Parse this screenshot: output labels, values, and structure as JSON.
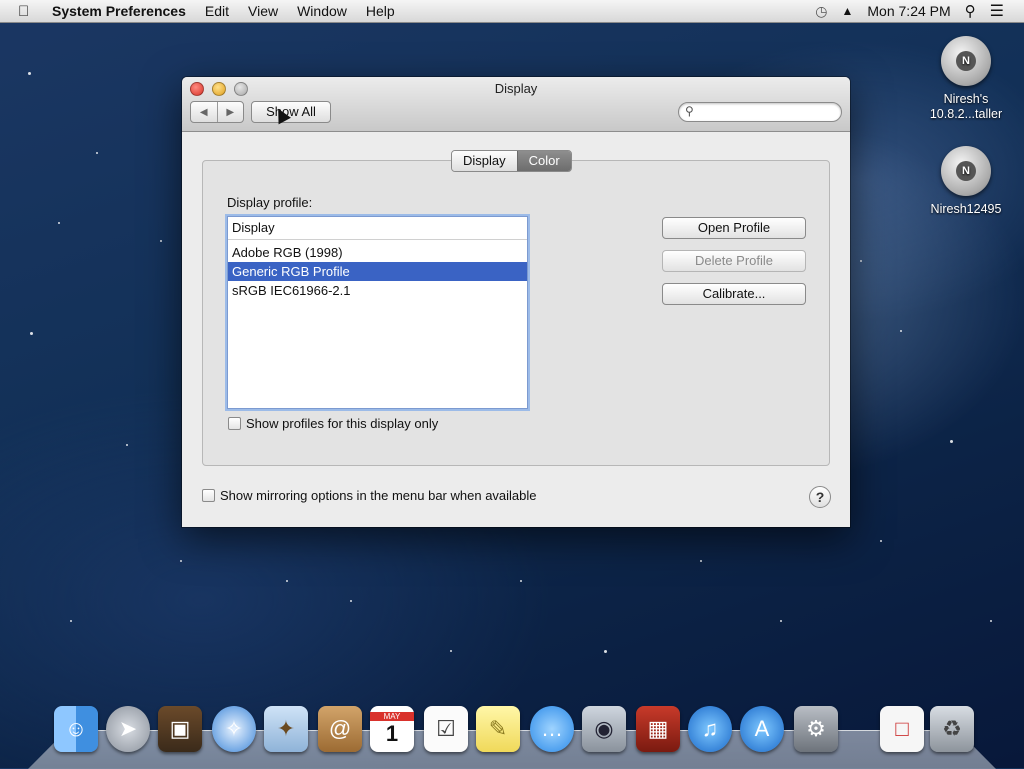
{
  "menubar": {
    "app_name": "System Preferences",
    "items": [
      "Edit",
      "View",
      "Window",
      "Help"
    ],
    "clock": "Mon 7:24 PM"
  },
  "window": {
    "title": "Display",
    "show_all_label": "Show All",
    "search_placeholder": "",
    "tabs": [
      {
        "label": "Display",
        "active": false
      },
      {
        "label": "Color",
        "active": true
      }
    ],
    "display_profile_label": "Display profile:",
    "profile_list": {
      "header": "Display",
      "items": [
        "Adobe RGB (1998)",
        "Generic RGB Profile",
        "sRGB IEC61966-2.1"
      ],
      "selected_index": 1
    },
    "buttons": {
      "open_profile": "Open Profile",
      "delete_profile": "Delete Profile",
      "calibrate": "Calibrate..."
    },
    "checkbox_profiles_only": "Show profiles for this display only",
    "checkbox_mirroring": "Show mirroring options in the menu bar when available",
    "help_symbol": "?"
  },
  "desktop": {
    "icons": [
      {
        "line1": "Niresh's",
        "line2": "10.8.2...taller"
      },
      {
        "line1": "Niresh12495",
        "line2": ""
      }
    ]
  },
  "dock": {
    "items": [
      "finder-icon",
      "launchpad-icon",
      "photo-browser-icon",
      "safari-icon",
      "mail-icon",
      "contacts-icon",
      "calendar-icon",
      "reminders-icon",
      "notes-icon",
      "messages-icon",
      "facetime-icon",
      "photo-booth-icon",
      "itunes-icon",
      "app-store-icon",
      "system-preferences-icon",
      "document-icon",
      "trash-icon"
    ],
    "calendar_month": "MAY",
    "calendar_day": "1"
  },
  "colors": {
    "selection": "#3a63c4",
    "focus_ring": "#9cbbe8"
  }
}
